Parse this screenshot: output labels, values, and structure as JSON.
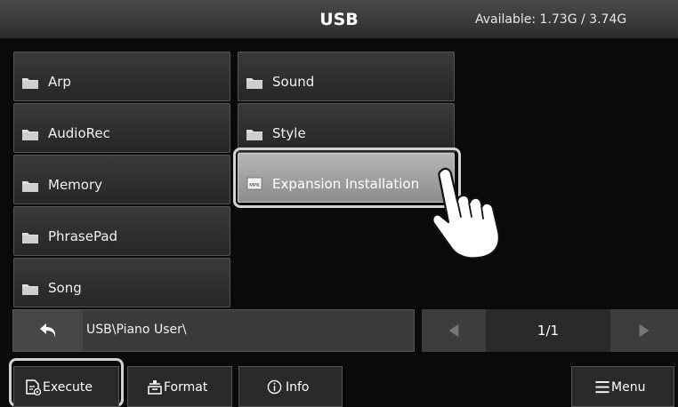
{
  "header": {
    "title": "USB",
    "available": "Available: 1.73G / 3.74G"
  },
  "folders": {
    "col1": [
      {
        "label": "Arp",
        "icon": "folder-icon"
      },
      {
        "label": "AudioRec",
        "icon": "folder-icon"
      },
      {
        "label": "Memory",
        "icon": "folder-icon"
      },
      {
        "label": "PhrasePad",
        "icon": "folder-icon"
      },
      {
        "label": "Song",
        "icon": "folder-icon"
      }
    ],
    "col2": [
      {
        "label": "Sound",
        "icon": "folder-icon"
      },
      {
        "label": "Style",
        "icon": "folder-icon"
      },
      {
        "label": "Expansion Installation",
        "icon": "mpk-file-icon",
        "selected": true
      }
    ]
  },
  "path": {
    "back_icon": "back-arrow-icon",
    "current": "USB\\Piano User\\"
  },
  "pager": {
    "page": "1/1",
    "prev_icon": "left-arrow-icon",
    "next_icon": "right-arrow-icon"
  },
  "toolbar": {
    "execute_label": "Execute",
    "format_label": "Format",
    "info_label": "Info",
    "menu_label": "Menu"
  },
  "colors": {
    "background": "#0a0a0a",
    "button": "#2f2f2f",
    "selected": "#a5a5a5",
    "highlight_ring": "#d2d2d2"
  }
}
